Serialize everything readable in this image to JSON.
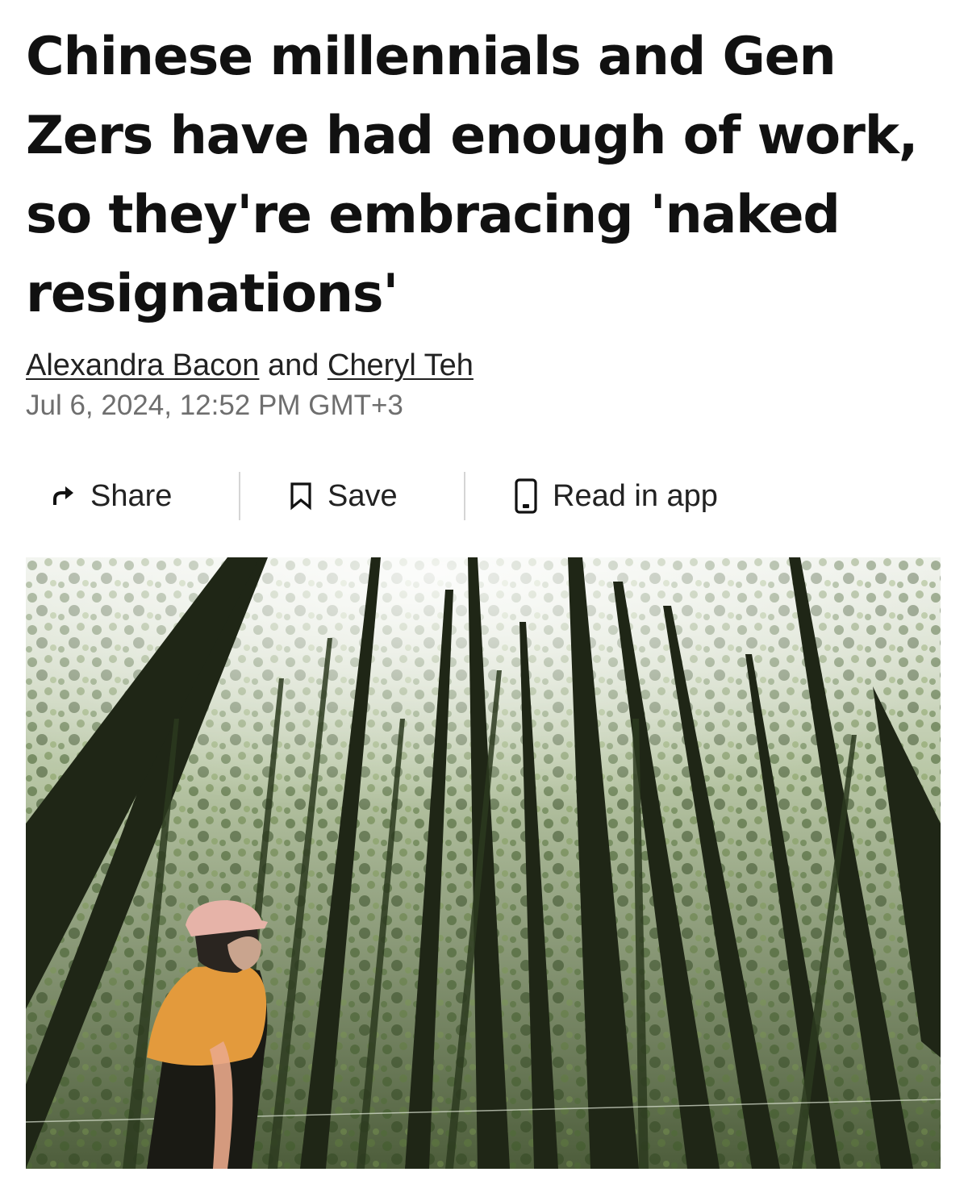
{
  "article": {
    "headline": "Chinese millennials and Gen Zers have had enough of work, so they're embracing 'naked resignations'",
    "author_1": "Alexandra Bacon",
    "byline_joiner": " and ",
    "author_2": "Cheryl Teh",
    "published": "Jul 6, 2024, 12:52 PM GMT+3"
  },
  "actions": {
    "share_label": "Share",
    "save_label": "Save",
    "read_in_app_label": "Read in app",
    "share_icon": "share-arrow-icon",
    "save_icon": "bookmark-icon",
    "read_in_app_icon": "phone-icon"
  },
  "hero_image": {
    "subject": "woman-in-forest-photo"
  },
  "colors": {
    "text": "#111111",
    "meta": "#6e6e6e",
    "divider": "#d5d5d5"
  }
}
